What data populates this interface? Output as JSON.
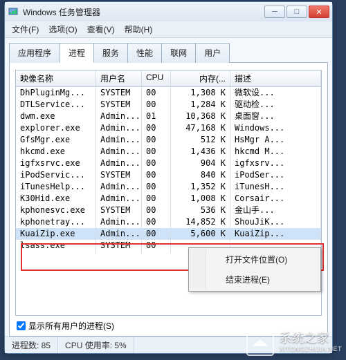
{
  "window": {
    "title": "Windows 任务管理器",
    "min_label": "─",
    "max_label": "□",
    "close_label": "✕"
  },
  "menu": {
    "file": "文件(F)",
    "options": "选项(O)",
    "view": "查看(V)",
    "help": "帮助(H)"
  },
  "tabs": {
    "apps": "应用程序",
    "processes": "进程",
    "services": "服务",
    "performance": "性能",
    "network": "联网",
    "users": "用户"
  },
  "columns": {
    "image": "映像名称",
    "user": "用户名",
    "cpu": "CPU",
    "memory": "内存(...",
    "desc": "描述"
  },
  "processes": [
    {
      "name": "DhPluginMg...",
      "user": "SYSTEM",
      "cpu": "00",
      "mem": "1,308 K",
      "desc": "微软设..."
    },
    {
      "name": "DTLService...",
      "user": "SYSTEM",
      "cpu": "00",
      "mem": "1,284 K",
      "desc": "驱动检..."
    },
    {
      "name": "dwm.exe",
      "user": "Admin...",
      "cpu": "01",
      "mem": "10,368 K",
      "desc": "桌面窗..."
    },
    {
      "name": "explorer.exe",
      "user": "Admin...",
      "cpu": "00",
      "mem": "47,168 K",
      "desc": "Windows..."
    },
    {
      "name": "GfsMgr.exe",
      "user": "Admin...",
      "cpu": "00",
      "mem": "512 K",
      "desc": "HsMgr A..."
    },
    {
      "name": "hkcmd.exe",
      "user": "Admin...",
      "cpu": "00",
      "mem": "1,436 K",
      "desc": "hkcmd M..."
    },
    {
      "name": "igfxsrvc.exe",
      "user": "Admin...",
      "cpu": "00",
      "mem": "904 K",
      "desc": "igfxsrv..."
    },
    {
      "name": "iPodServic...",
      "user": "SYSTEM",
      "cpu": "00",
      "mem": "840 K",
      "desc": "iPodSer..."
    },
    {
      "name": "iTunesHelp...",
      "user": "Admin...",
      "cpu": "00",
      "mem": "1,352 K",
      "desc": "iTunesH..."
    },
    {
      "name": "K30Hid.exe",
      "user": "Admin...",
      "cpu": "00",
      "mem": "1,008 K",
      "desc": "Corsair..."
    },
    {
      "name": "kphonesvc.exe",
      "user": "SYSTEM",
      "cpu": "00",
      "mem": "536 K",
      "desc": "金山手..."
    },
    {
      "name": "kphonetray...",
      "user": "Admin...",
      "cpu": "00",
      "mem": "14,852 K",
      "desc": "ShouJiK..."
    },
    {
      "name": "KuaiZip.exe",
      "user": "Admin...",
      "cpu": "00",
      "mem": "5,600 K",
      "desc": "KuaiZip..."
    },
    {
      "name": "lsass.exe",
      "user": "SYSTEM",
      "cpu": "00",
      "mem": "",
      "desc": ""
    }
  ],
  "context_menu": {
    "open_location": "打开文件位置(O)",
    "end_process": "结束进程(E)"
  },
  "show_all_users": "显示所有用户的进程(S)",
  "status": {
    "proc_count_label": "进程数: 85",
    "cpu_usage_label": "CPU 使用率: 5%"
  },
  "watermark": {
    "line1": "系统之家",
    "line2": "XITONGZHIJIA.NET"
  }
}
